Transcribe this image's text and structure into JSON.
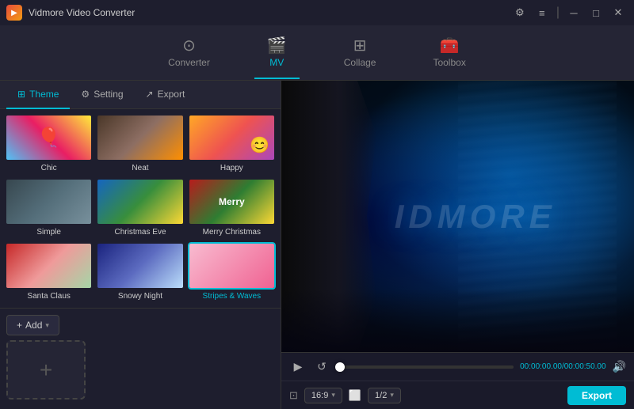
{
  "app": {
    "title": "Vidmore Video Converter",
    "logo": "▶"
  },
  "titlebar": {
    "controls": {
      "settings": "⚙",
      "menu": "≡",
      "minimize": "─",
      "maximize": "□",
      "close": "✕"
    }
  },
  "nav": {
    "tabs": [
      {
        "id": "converter",
        "label": "Converter",
        "icon": "⊙",
        "active": false
      },
      {
        "id": "mv",
        "label": "MV",
        "icon": "🎬",
        "active": true
      },
      {
        "id": "collage",
        "label": "Collage",
        "icon": "⊞",
        "active": false
      },
      {
        "id": "toolbox",
        "label": "Toolbox",
        "icon": "🧰",
        "active": false
      }
    ]
  },
  "subtabs": [
    {
      "id": "theme",
      "label": "Theme",
      "icon": "⊞",
      "active": true
    },
    {
      "id": "setting",
      "label": "Setting",
      "icon": "⚙",
      "active": false
    },
    {
      "id": "export",
      "label": "Export",
      "icon": "↗",
      "active": false
    }
  ],
  "themes": [
    {
      "id": "chic",
      "label": "Chic",
      "active": false
    },
    {
      "id": "neat",
      "label": "Neat",
      "active": false
    },
    {
      "id": "happy",
      "label": "Happy",
      "active": false
    },
    {
      "id": "simple",
      "label": "Simple",
      "active": false
    },
    {
      "id": "christmas-eve",
      "label": "Christmas Eve",
      "active": false
    },
    {
      "id": "merry-christmas",
      "label": "Merry Christmas",
      "active": false
    },
    {
      "id": "santa-claus",
      "label": "Santa Claus",
      "active": false
    },
    {
      "id": "snowy-night",
      "label": "Snowy Night",
      "active": false
    },
    {
      "id": "stripes-waves",
      "label": "Stripes & Waves",
      "active": true
    }
  ],
  "add_button": {
    "label": "Add",
    "icon": "+"
  },
  "player": {
    "time_current": "00:00:00.00",
    "time_total": "00:00:50.00",
    "time_display": "00:00:00.00/00:00:50.00",
    "progress_percent": 2,
    "ratio": "16:9",
    "page": "1/2",
    "play_icon": "▶",
    "loop_icon": "↺",
    "volume_icon": "🔊"
  },
  "preview": {
    "watermark_text": "IDMORE"
  },
  "export_button": "Export"
}
